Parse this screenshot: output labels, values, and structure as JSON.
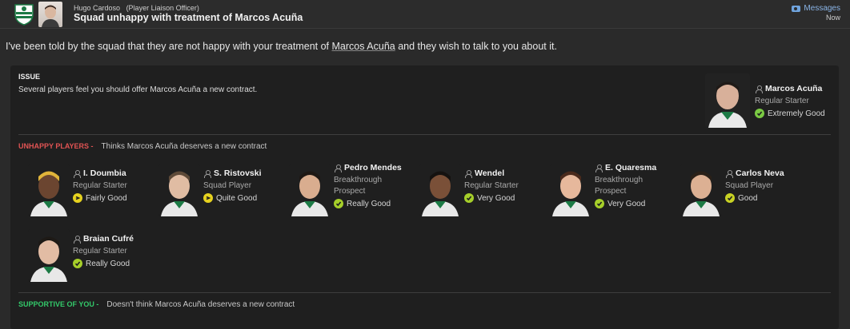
{
  "header": {
    "sender_name": "Hugo Cardoso",
    "sender_role": "(Player Liaison Officer)",
    "subject": "Squad unhappy with treatment of Marcos Acuña",
    "messages_label": "Messages",
    "time": "Now"
  },
  "body": {
    "pre": "I've been told by the squad that they are not happy with your treatment of ",
    "player": "Marcos Acuña",
    "post": " and they wish to talk to you about it."
  },
  "issue": {
    "title": "ISSUE",
    "text": "Several players feel you should offer Marcos Acuña a new contract."
  },
  "featured_player": {
    "name": "Marcos Acuña",
    "role": "Regular Starter",
    "status": "Extremely Good",
    "status_color": "#7ac943"
  },
  "unhappy": {
    "label": "UNHAPPY PLAYERS -",
    "desc": "Thinks Marcos Acuña deserves a new contract",
    "players": [
      {
        "name": "I. Doumbia",
        "role": "Regular Starter",
        "status": "Fairly Good",
        "status_color": "#e6d21f"
      },
      {
        "name": "S. Ristovski",
        "role": "Squad Player",
        "status": "Quite Good",
        "status_color": "#e6d21f"
      },
      {
        "name": "Pedro Mendes",
        "role": "Breakthrough Prospect",
        "status": "Really Good",
        "status_color": "#a6cf2a"
      },
      {
        "name": "Wendel",
        "role": "Regular Starter",
        "status": "Very Good",
        "status_color": "#a6cf2a"
      },
      {
        "name": "E. Quaresma",
        "role": "Breakthrough Prospect",
        "status": "Very Good",
        "status_color": "#a6cf2a"
      },
      {
        "name": "Carlos Neva",
        "role": "Squad Player",
        "status": "Good",
        "status_color": "#c8d224"
      },
      {
        "name": "Braian Cufré",
        "role": "Regular Starter",
        "status": "Really Good",
        "status_color": "#a6cf2a"
      }
    ]
  },
  "supportive": {
    "label": "SUPPORTIVE OF YOU -",
    "desc": "Doesn't think Marcos Acuña deserves a new contract"
  }
}
